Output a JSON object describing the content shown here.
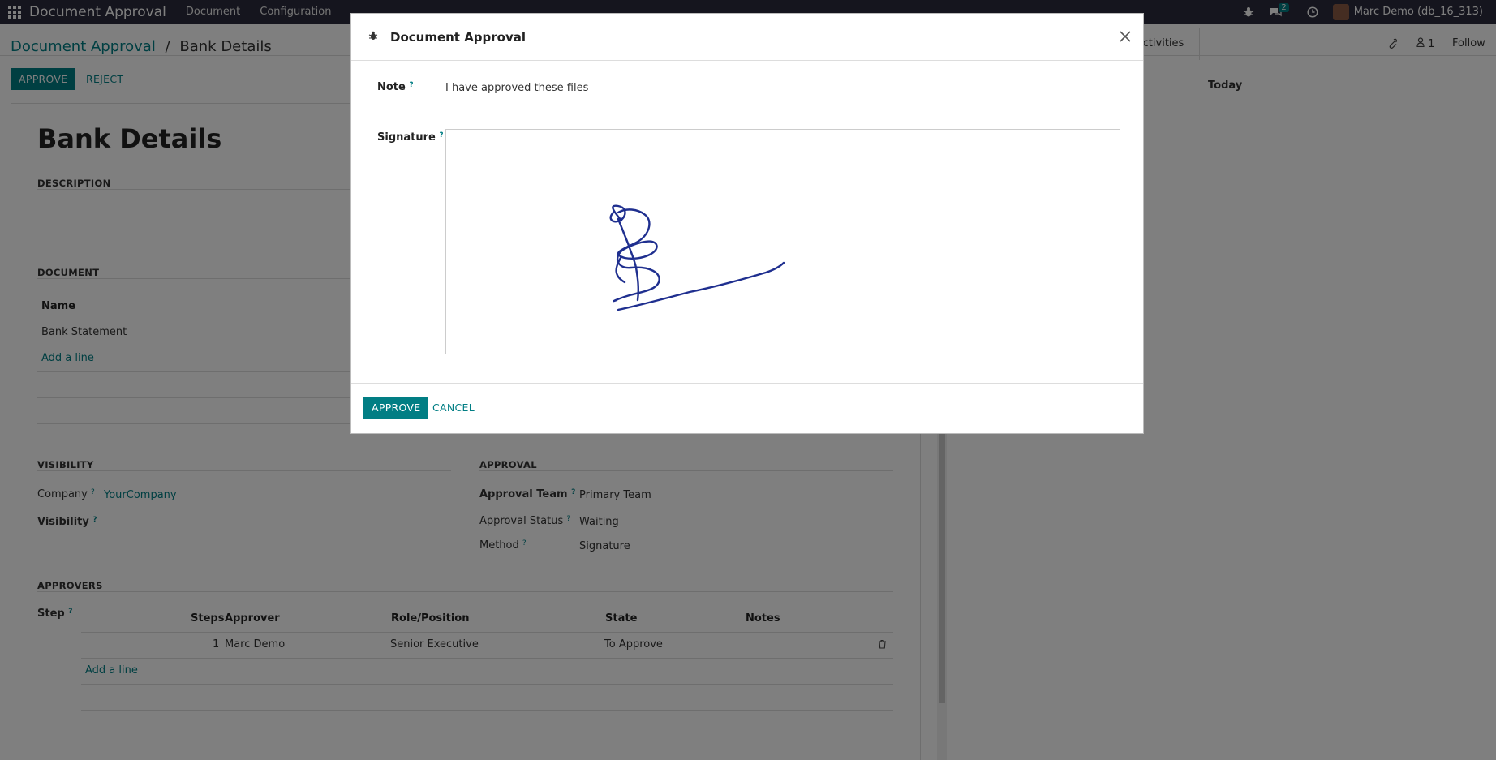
{
  "navbar": {
    "app_name": "Document Approval",
    "menu": [
      "Document",
      "Configuration"
    ],
    "messages_badge": "2",
    "user": "Marc Demo (db_16_313)"
  },
  "breadcrumb": {
    "parent": "Document Approval",
    "separator": "/",
    "current": "Bank Details"
  },
  "statusbar": {
    "approve": "APPROVE",
    "reject": "REJECT"
  },
  "chatter": {
    "activities": "Activities",
    "followers_count": "1",
    "follow": "Follow",
    "today": "Today"
  },
  "form": {
    "title": "Bank Details",
    "description_section": "DESCRIPTION",
    "document_section": "DOCUMENT",
    "doc_col_name": "Name",
    "doc_rows": [
      "Bank Statement"
    ],
    "add_line": "Add a line",
    "visibility_section": "VISIBILITY",
    "company_label": "Company",
    "company_value": "YourCompany",
    "visibility_label": "Visibility",
    "approval_section": "APPROVAL",
    "approval_team_label": "Approval Team",
    "approval_team_value": "Primary Team",
    "approval_status_label": "Approval Status",
    "approval_status_value": "Waiting",
    "method_label": "Method",
    "method_value": "Signature",
    "approvers_section": "APPROVERS",
    "step_label": "Step",
    "approver_cols": [
      "Steps",
      "Approver",
      "Role/Position",
      "State",
      "Notes"
    ],
    "approver_rows": [
      {
        "steps": "1",
        "approver": "Marc Demo",
        "role": "Senior Executive",
        "state": "To Approve",
        "notes": ""
      }
    ],
    "add_line_2": "Add a line",
    "help_mark": "?"
  },
  "modal": {
    "title": "Document Approval",
    "note_label": "Note",
    "note_value": "I have approved these files",
    "signature_label": "Signature",
    "approve": "APPROVE",
    "cancel": "CANCEL"
  },
  "colors": {
    "accent": "#017e84",
    "navbar": "#2b2b3c",
    "signature_ink": "#1f2f8f"
  }
}
